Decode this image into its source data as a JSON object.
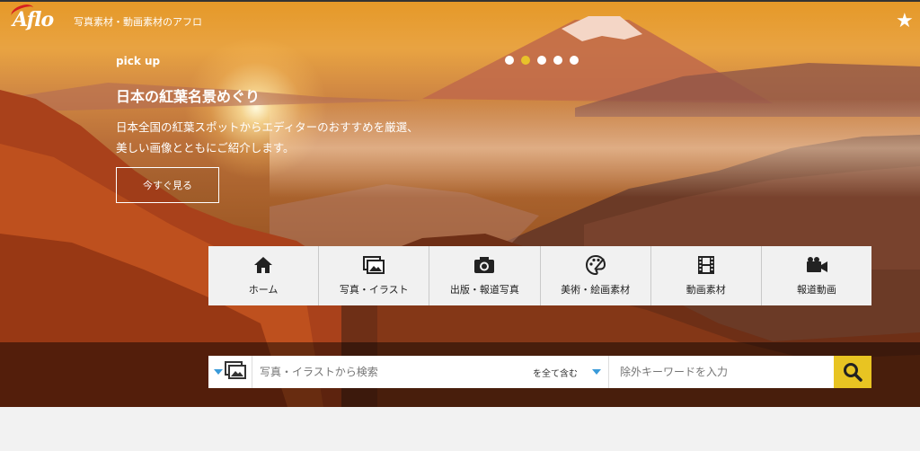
{
  "brand": {
    "logo_text": "Aflo",
    "tagline": "写真素材・動画素材のアフロ"
  },
  "header": {
    "favorite_icon": "star-icon"
  },
  "hero": {
    "pickup_label": "pick up",
    "title": "日本の紅葉名景めぐり",
    "description_line1": "日本全国の紅葉スポットからエディターのおすすめを厳選、",
    "description_line2": "美しい画像とともにご紹介します。",
    "cta_label": "今すぐ見る",
    "carousel": {
      "count": 5,
      "active_index": 1,
      "active_color": "#e8c22a"
    }
  },
  "categories": [
    {
      "label": "ホーム",
      "icon": "home-icon"
    },
    {
      "label": "写真・イラスト",
      "icon": "photo-icon"
    },
    {
      "label": "出版・報道写真",
      "icon": "camera-icon"
    },
    {
      "label": "美術・絵画素材",
      "icon": "palette-icon"
    },
    {
      "label": "動画素材",
      "icon": "film-icon"
    },
    {
      "label": "報道動画",
      "icon": "video-camera-icon"
    }
  ],
  "search": {
    "type_icon": "image-type-icon",
    "placeholder": "写真・イラストから検索",
    "mode_label": "を全て含む",
    "exclude_placeholder": "除外キーワードを入力",
    "button_icon": "search-icon",
    "accent_color": "#e8c422"
  }
}
